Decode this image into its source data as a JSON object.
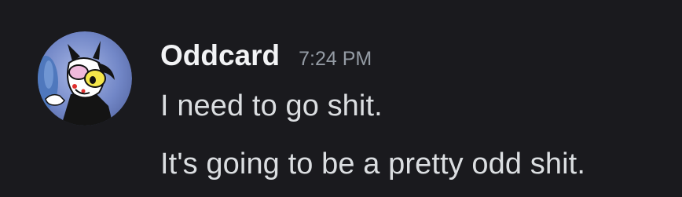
{
  "message": {
    "author": "Oddcard",
    "timestamp": "7:24 PM",
    "lines": [
      "I need to go shit.",
      "It's going to be a pretty odd shit."
    ]
  },
  "avatar": {
    "icon": "cartoon-character-avatar",
    "colors": {
      "background": "#6f84c4",
      "face": "#ffffff",
      "eye_left": "#f0b9dc",
      "eye_right": "#f4e64a",
      "body": "#141414"
    }
  },
  "colors": {
    "background": "#1a1a1e",
    "username": "#f2f3f5",
    "timestamp": "#949ba4",
    "text": "#dbdee1"
  }
}
